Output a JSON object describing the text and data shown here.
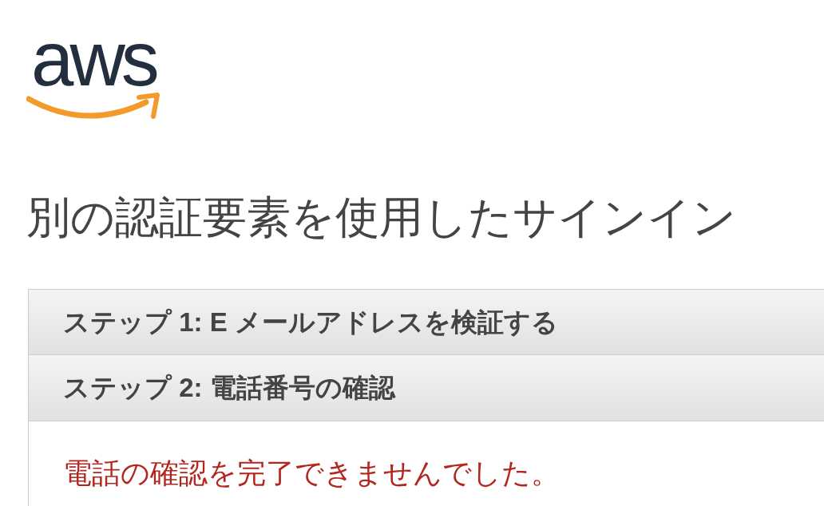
{
  "logo": {
    "text": "aws"
  },
  "title": "別の認証要素を使用したサインイン",
  "steps": [
    {
      "label": "ステップ 1: E メールアドレスを検証する"
    },
    {
      "label": "ステップ 2: 電話番号の確認",
      "message": "電話の確認を完了できませんでした。"
    }
  ]
}
